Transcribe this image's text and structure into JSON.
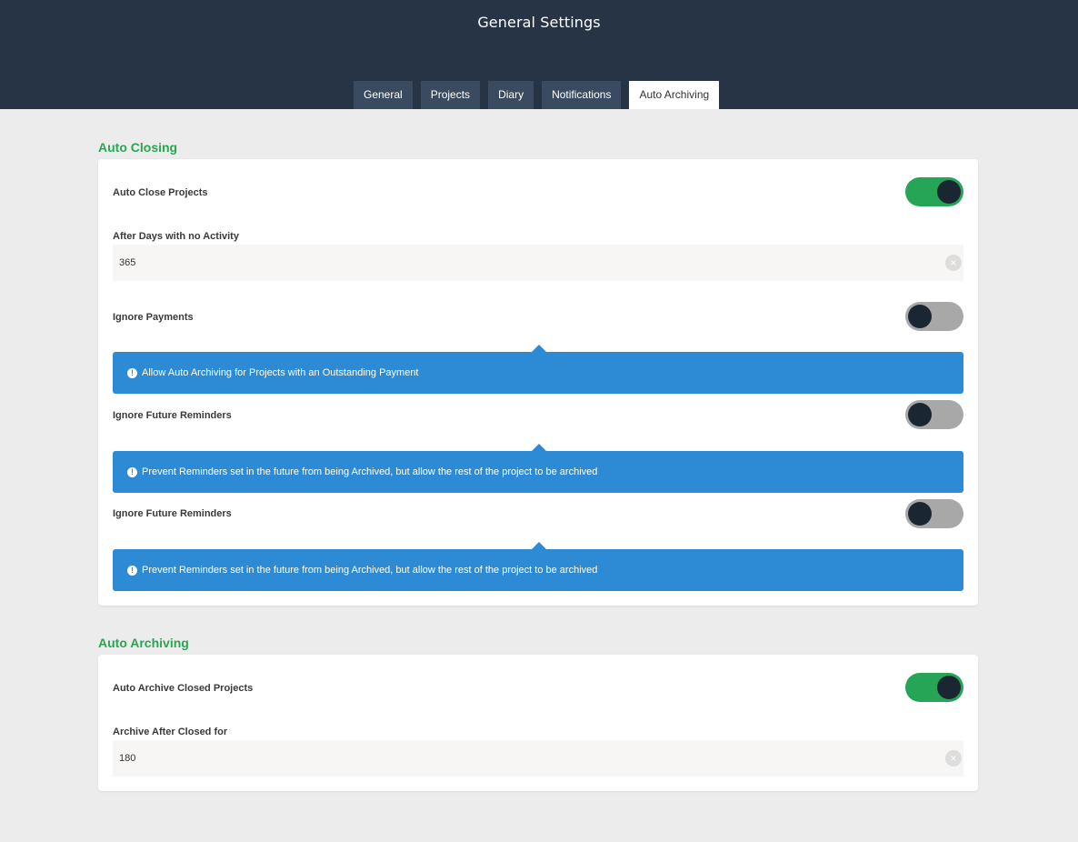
{
  "header": {
    "title": "General Settings",
    "tabs": [
      {
        "label": "General"
      },
      {
        "label": "Projects"
      },
      {
        "label": "Diary"
      },
      {
        "label": "Notifications"
      },
      {
        "label": "Auto Archiving"
      }
    ],
    "active_tab": "Auto Archiving"
  },
  "auto_closing": {
    "title": "Auto Closing",
    "auto_close_projects": {
      "label": "Auto Close Projects",
      "enabled": true
    },
    "after_days": {
      "label": "After Days with no Activity",
      "value": "365"
    },
    "ignore_payments": {
      "label": "Ignore Payments",
      "enabled": false,
      "info": "Allow Auto Archiving for Projects with an Outstanding Payment"
    },
    "ignore_future_reminders_1": {
      "label": "Ignore Future Reminders",
      "enabled": false,
      "info": "Prevent Reminders set in the future from being Archived, but allow the rest of the project to be archived"
    },
    "ignore_future_reminders_2": {
      "label": "Ignore Future Reminders",
      "enabled": false,
      "info": "Prevent Reminders set in the future from being Archived, but allow the rest of the project to be archived"
    }
  },
  "auto_archiving": {
    "title": "Auto Archiving",
    "auto_archive_closed": {
      "label": "Auto Archive Closed Projects",
      "enabled": true
    },
    "archive_after": {
      "label": "Archive After Closed for",
      "value": "180"
    }
  },
  "icons": {
    "clear": "clear-circle-icon",
    "info": "info-icon"
  },
  "colors": {
    "header_bg": "#263445",
    "accent_green": "#27a557",
    "info_blue": "#2d8bd6",
    "toggle_off": "#a8a8a8"
  }
}
